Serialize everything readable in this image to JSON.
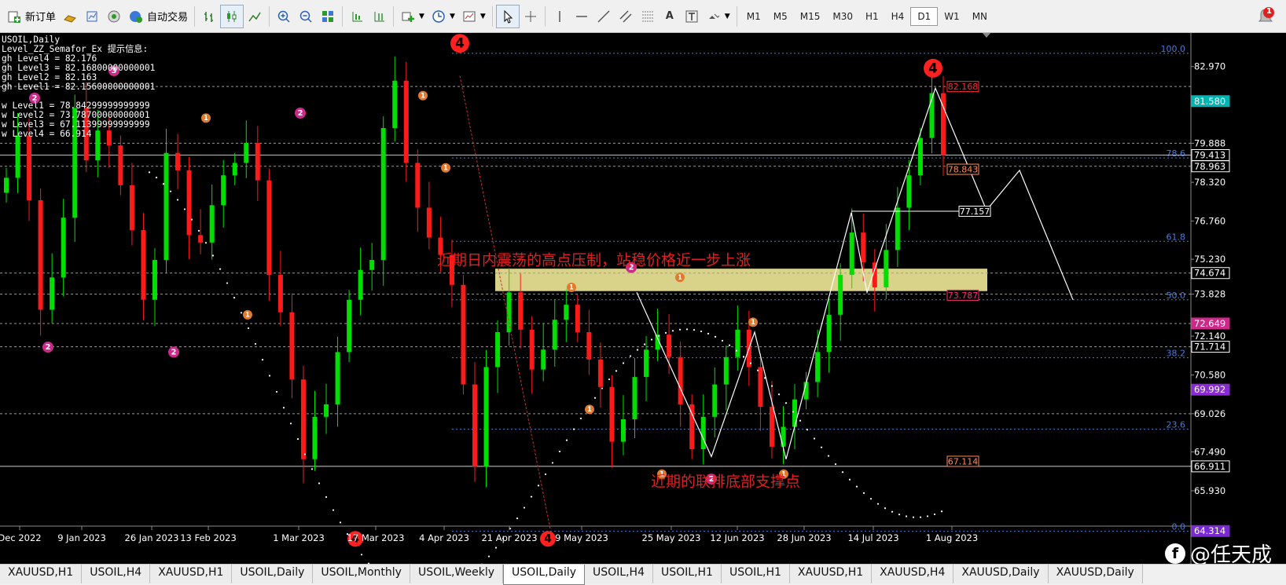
{
  "toolbar": {
    "new_order": "新订单",
    "auto_trade": "自动交易",
    "timeframes": [
      "M1",
      "M5",
      "M15",
      "M30",
      "H1",
      "H4",
      "D1",
      "W1",
      "MN"
    ],
    "active_timeframe": "D1",
    "text_tool": "A",
    "notification_count": "1"
  },
  "chart": {
    "symbol_label": "USOIL,Daily",
    "indicator_label": "Level_ZZ_Semafor_Ex 提示信息:",
    "info_lines": [
      "gh Level4 = 82.176",
      "gh Level3 = 82.16800000000001",
      "gh Level2 = 82.163",
      "gh Level1 = 82.15600000000001",
      "",
      "w Level1 = 78.84299999999999",
      "w Level2 = 73.78700000000001",
      "w Level3 = 67.11399999999999",
      "w Level4 = 66.914"
    ],
    "annotation_resistance": "近期日内震荡的高点压制，站稳价格近一步上涨",
    "annotation_support": "近期的联排底部支撑点",
    "fib_levels": [
      {
        "label": "100.0",
        "price": 83.5
      },
      {
        "label": "78.6",
        "price": 79.3
      },
      {
        "label": "61.8",
        "price": 75.95
      },
      {
        "label": "50.0",
        "price": 73.6
      },
      {
        "label": "38.2",
        "price": 71.27
      },
      {
        "label": "23.6",
        "price": 68.4
      },
      {
        "label": "0.0",
        "price": 64.3
      }
    ],
    "price_ticks": [
      "82.970",
      "79.888",
      "78.320",
      "76.760",
      "75.230",
      "73.828",
      "72.140",
      "70.580",
      "69.026",
      "67.490",
      "65.930"
    ],
    "price_tick_values": [
      82.97,
      79.888,
      78.32,
      76.76,
      75.23,
      73.828,
      72.14,
      70.58,
      69.026,
      67.49,
      65.93
    ],
    "highlight_labels": [
      {
        "text": "81.580",
        "price": 81.58,
        "bg": "#00b4b4"
      },
      {
        "text": "79.413",
        "price": 79.413,
        "bg": "#000000"
      },
      {
        "text": "78.963",
        "price": 78.963,
        "bg": "#000000"
      },
      {
        "text": "74.674",
        "price": 74.674,
        "bg": "#000000"
      },
      {
        "text": "72.649",
        "price": 72.649,
        "bg": "#cc2a8a"
      },
      {
        "text": "71.714",
        "price": 71.714,
        "bg": "#000000"
      },
      {
        "text": "69.992",
        "price": 69.992,
        "bg": "#8a2ad1"
      },
      {
        "text": "66.911",
        "price": 66.911,
        "bg": "#000000"
      },
      {
        "text": "64.314",
        "price": 64.314,
        "bg": "#7a2ad1"
      }
    ],
    "level_boxes": [
      {
        "text": "82.168",
        "price": 82.168,
        "color": "#ff2b2b"
      },
      {
        "text": "78.843",
        "price": 78.843,
        "color": "#ff8c5a"
      },
      {
        "text": "77.157",
        "price": 77.157,
        "color": "#ffffff"
      },
      {
        "text": "73.787",
        "price": 73.787,
        "color": "#ff2b7a"
      },
      {
        "text": "67.114",
        "price": 67.114,
        "color": "#ff8c5a"
      }
    ],
    "date_ticks": [
      "Dec 2022",
      "9 Jan 2023",
      "26 Jan 2023",
      "13 Feb 2023",
      "1 Mar 2023",
      "17 Mar 2023",
      "4 Apr 2023",
      "21 Apr 2023",
      "9 May 2023",
      "25 May 2023",
      "12 Jun 2023",
      "28 Jun 2023",
      "14 Jul 2023",
      "1 Aug 2023"
    ],
    "colors": {
      "bull": "#00e000",
      "bear": "#ff1a1a",
      "zone": "#d9d38a",
      "fib": "#4a7bd6"
    }
  },
  "tabs": [
    "XAUUSD,H1",
    "USOIL,H4",
    "XAUUSD,H1",
    "USOIL,Daily",
    "USOIL,Monthly",
    "USOIL,Weekly",
    "USOIL,Daily",
    "USOIL,H4",
    "USOIL,H1",
    "USOIL,H1",
    "XAUUSD,H1",
    "XAUUSD,H4",
    "XAUUSD,Daily",
    "XAUUSD,Daily"
  ],
  "active_tab_index": 6,
  "watermark": "@任天成"
}
